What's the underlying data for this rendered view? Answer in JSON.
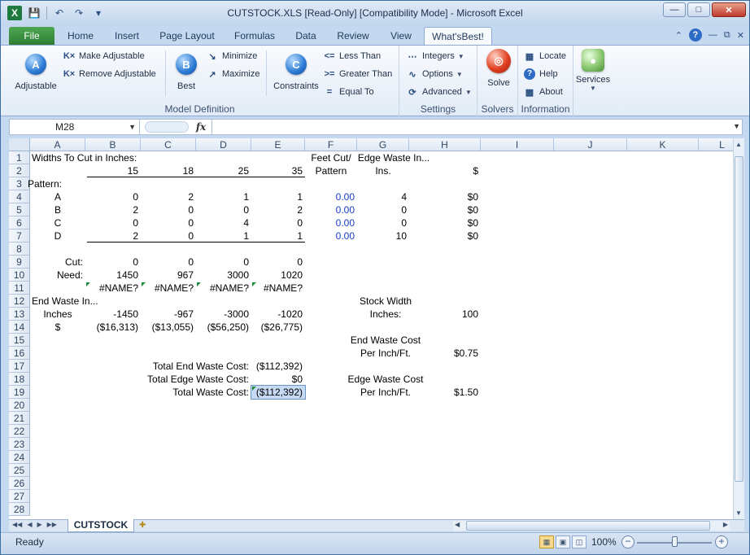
{
  "window": {
    "title": "CUTSTOCK.XLS  [Read-Only]  [Compatibility Mode]  -  Microsoft Excel",
    "app_icon": "X"
  },
  "ribbon_tabs": [
    "File",
    "Home",
    "Insert",
    "Page Layout",
    "Formulas",
    "Data",
    "Review",
    "View",
    "What'sBest!"
  ],
  "ribbon": {
    "adjustable": "Adjustable",
    "make_adjustable": "Make Adjustable",
    "remove_adjustable": "Remove Adjustable",
    "best": "Best",
    "minimize": "Minimize",
    "maximize": "Maximize",
    "constraints": "Constraints",
    "less_than": "Less Than",
    "greater_than": "Greater Than",
    "equal_to": "Equal To",
    "less_than_icon": "<=",
    "greater_than_icon": ">=",
    "equal_to_icon": "=",
    "integers": "Integers",
    "options": "Options",
    "advanced": "Advanced",
    "solve": "Solve",
    "locate": "Locate",
    "help": "Help",
    "about": "About",
    "services": "Services",
    "group_model_definition": "Model Definition",
    "group_settings": "Settings",
    "group_solvers": "Solvers",
    "group_information": "Information"
  },
  "formula_bar": {
    "name_box": "M28",
    "fx": "fx",
    "formula": ""
  },
  "columns": [
    "A",
    "B",
    "C",
    "D",
    "E",
    "F",
    "G",
    "H",
    "I",
    "J",
    "K",
    "L"
  ],
  "rows": [
    "1",
    "2",
    "3",
    "4",
    "5",
    "6",
    "7",
    "8",
    "9",
    "10",
    "11",
    "12",
    "13",
    "14",
    "15",
    "16",
    "17",
    "18",
    "19",
    "20",
    "21",
    "22",
    "23",
    "24",
    "25",
    "26",
    "27",
    "28"
  ],
  "cells": {
    "A1": "Widths To Cut in Inches:",
    "F1": "Feet Cut/",
    "G1": "Edge Waste In...",
    "B2": "15",
    "C2": "18",
    "D2": "25",
    "E2": "35",
    "F2": "Pattern",
    "G2": "Ins.",
    "H2": "$",
    "A3": "Pattern:",
    "A4": "A",
    "B4": "0",
    "C4": "2",
    "D4": "1",
    "E4": "1",
    "F4": "0.00",
    "G4": "4",
    "H4": "$0",
    "A5": "B",
    "B5": "2",
    "C5": "0",
    "D5": "0",
    "E5": "2",
    "F5": "0.00",
    "G5": "0",
    "H5": "$0",
    "A6": "C",
    "B6": "0",
    "C6": "0",
    "D6": "4",
    "E6": "0",
    "F6": "0.00",
    "G6": "0",
    "H6": "$0",
    "A7": "D",
    "B7": "2",
    "C7": "0",
    "D7": "1",
    "E7": "1",
    "F7": "0.00",
    "G7": "10",
    "H7": "$0",
    "A9": "Cut:",
    "B9": "0",
    "C9": "0",
    "D9": "0",
    "E9": "0",
    "A10": "Need:",
    "B10": "1450",
    "C10": "967",
    "D10": "3000",
    "E10": "1020",
    "B11": "#NAME?",
    "C11": "#NAME?",
    "D11": "#NAME?",
    "E11": "#NAME?",
    "A12": "End Waste In...",
    "G12": "Stock Width",
    "A13": "Inches",
    "B13": "-1450",
    "C13": "-967",
    "D13": "-3000",
    "E13": "-1020",
    "G13": "Inches:",
    "H13": "100",
    "A14": "$",
    "B14": "($16,313)",
    "C14": "($13,055)",
    "D14": "($56,250)",
    "E14": "($26,775)",
    "G15": "End Waste Cost",
    "G16": "Per Inch/Ft.",
    "H16": "$0.75",
    "C17": "Total End Waste Cost:",
    "E17": "($112,392)",
    "C18": "Total Edge Waste Cost:",
    "E18": "$0",
    "G18": "Edge Waste Cost",
    "C19": "Total Waste Cost:",
    "E19": "($112,392)",
    "G19": "Per Inch/Ft.",
    "H19": "$1.50"
  },
  "sheet_tab": "CUTSTOCK",
  "status": {
    "ready": "Ready",
    "zoom": "100%"
  },
  "colors": {
    "accent_green": "#2e7d32",
    "value_blue": "#1a3cc9",
    "selection": "#c6dbf3"
  }
}
